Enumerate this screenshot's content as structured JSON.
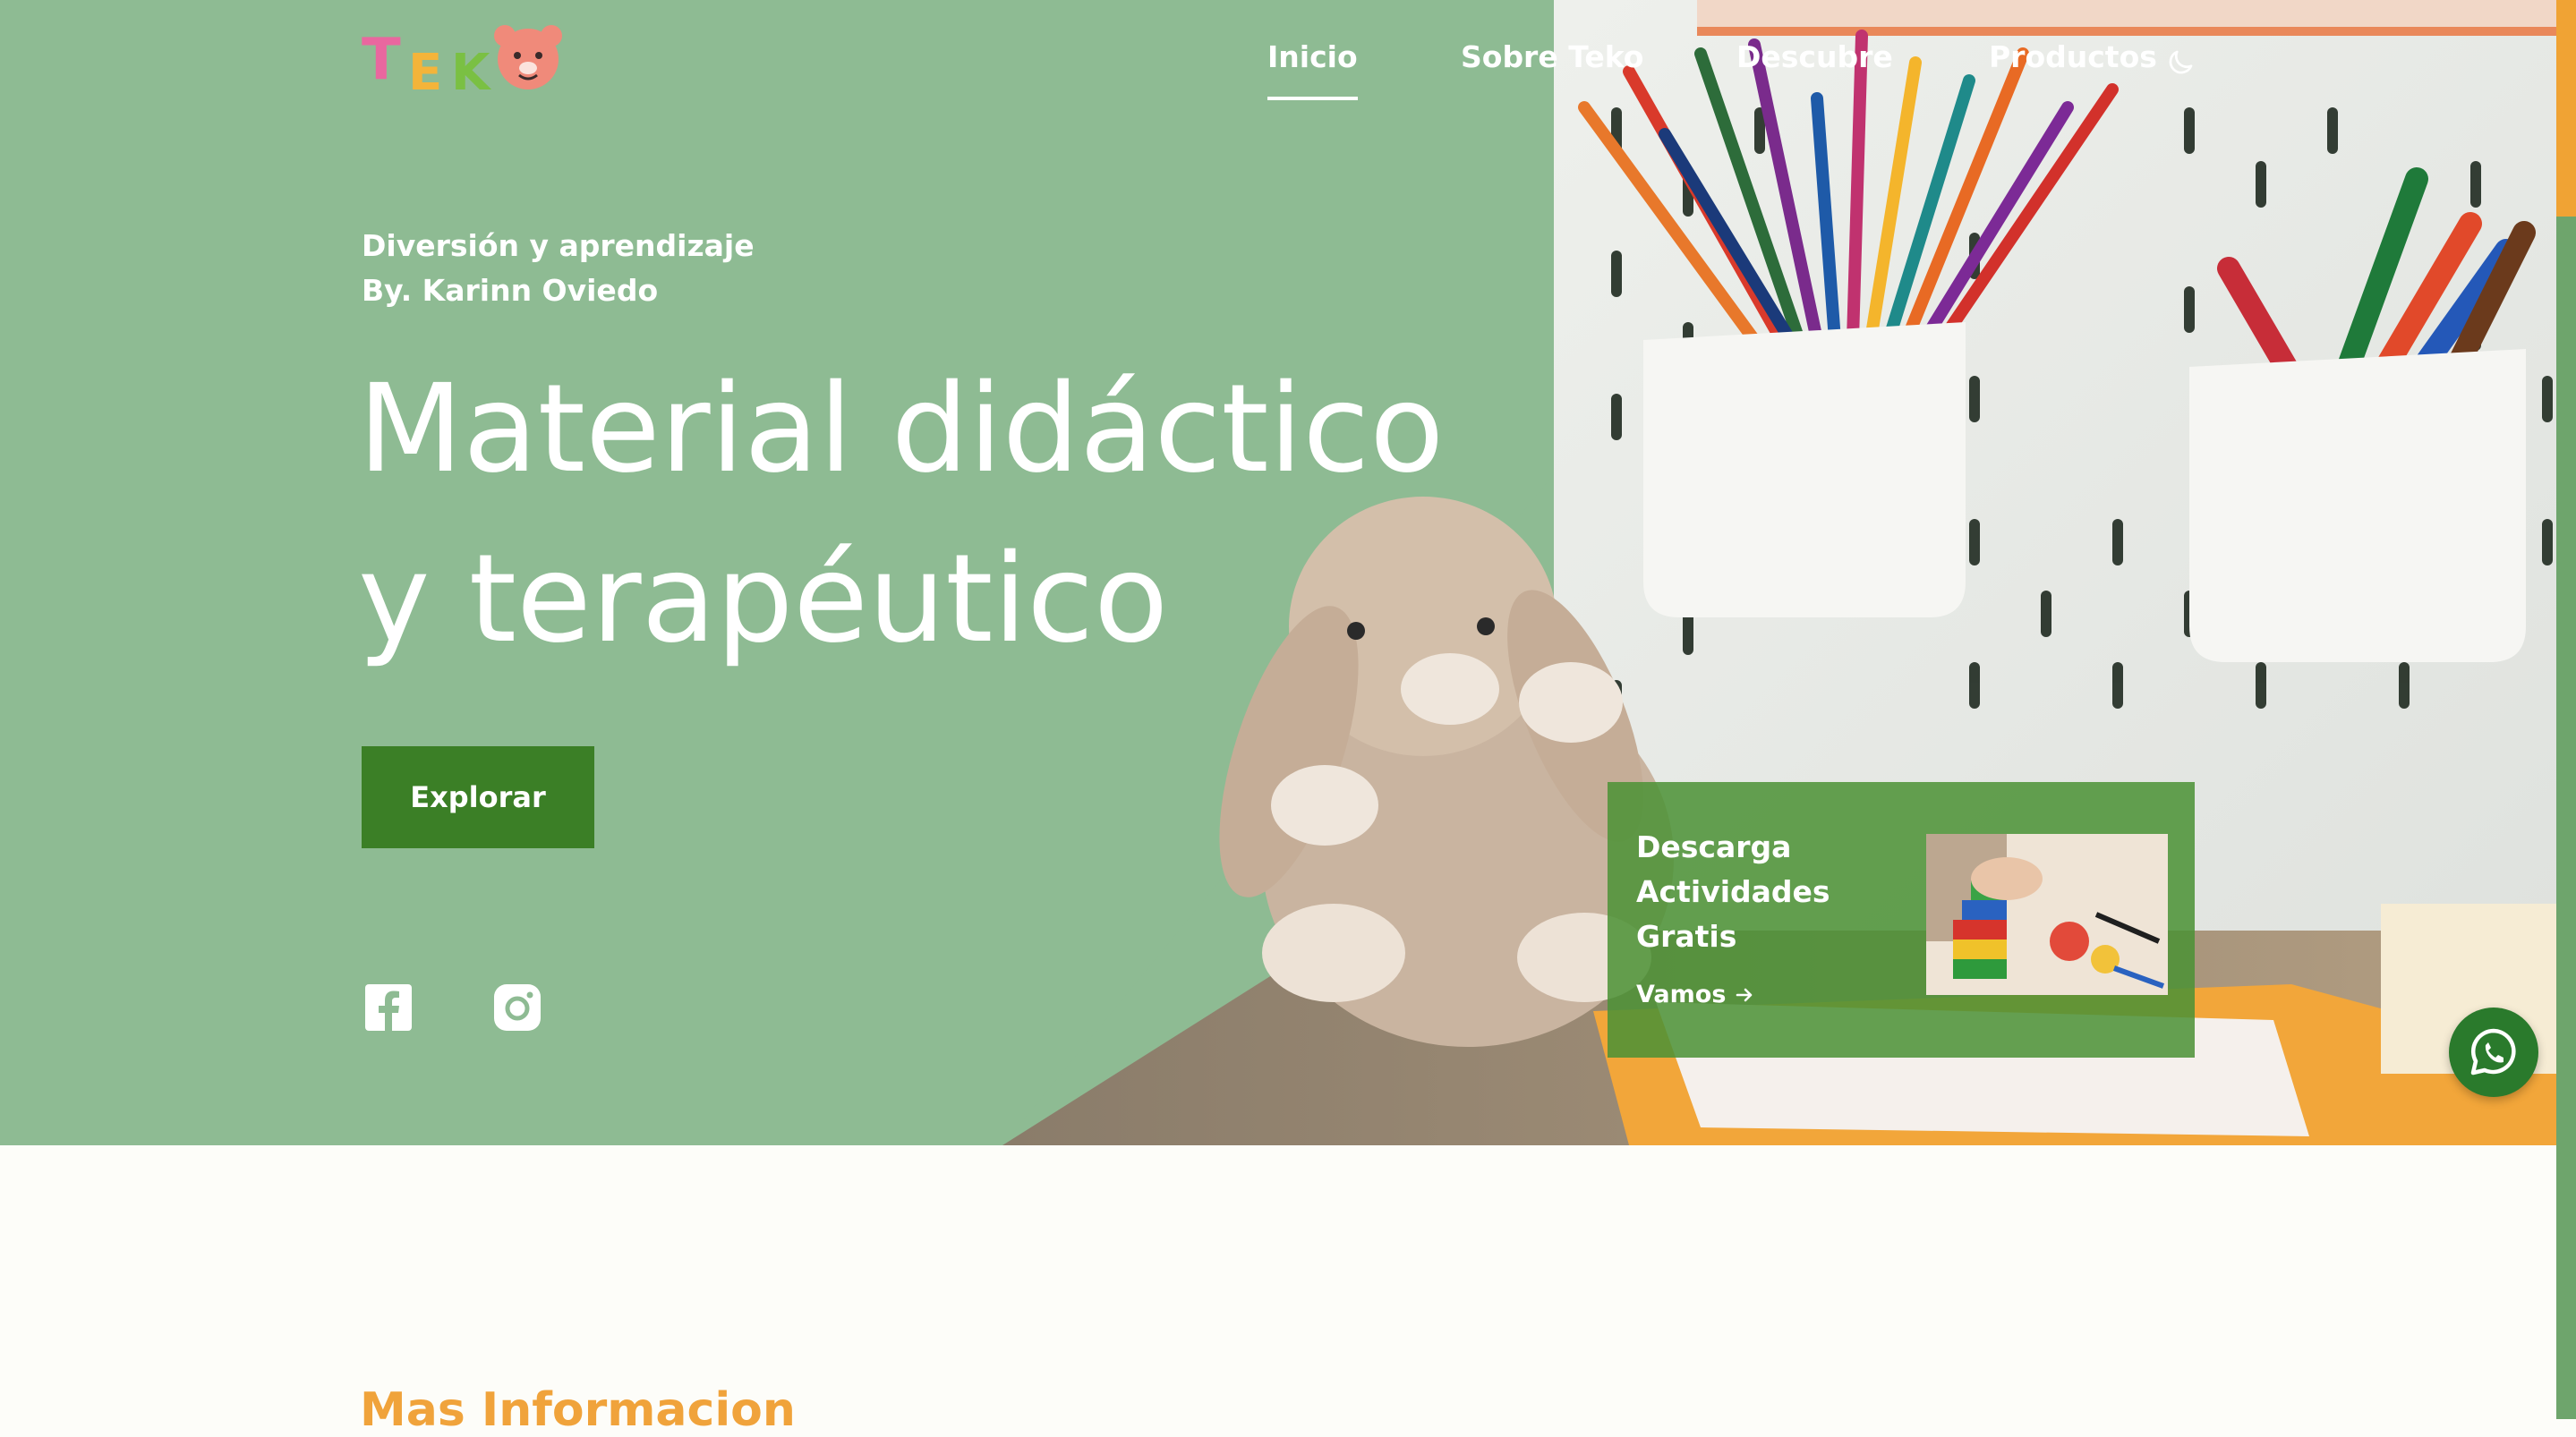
{
  "brand": {
    "logo_text": "TEKO"
  },
  "nav": {
    "items": [
      {
        "label": "Inicio",
        "active": true
      },
      {
        "label": "Sobre Teko",
        "active": false
      },
      {
        "label": "Descubre",
        "active": false
      },
      {
        "label": "Productos",
        "active": false
      }
    ],
    "theme_toggle_icon": "moon-icon"
  },
  "hero": {
    "tagline_line1": "Diversión y aprendizaje",
    "tagline_line2": "By. Karinn Oviedo",
    "headline_line1": "Material didáctico",
    "headline_line2": "y terapéutico",
    "cta_label": "Explorar"
  },
  "social": {
    "icons": [
      "facebook-icon",
      "instagram-icon"
    ]
  },
  "promo": {
    "title_line1": "Descarga",
    "title_line2": "Actividades",
    "title_line3": "Gratis",
    "link_label": "Vamos",
    "link_icon": "arrow-right-icon"
  },
  "whatsapp": {
    "icon": "whatsapp-icon"
  },
  "section": {
    "heading": "Mas Informacion"
  },
  "colors": {
    "hero_green": "#8ebb93",
    "button_green": "#3b7f26",
    "accent_orange": "#f0a33b",
    "page_background": "#fdfdf9"
  }
}
